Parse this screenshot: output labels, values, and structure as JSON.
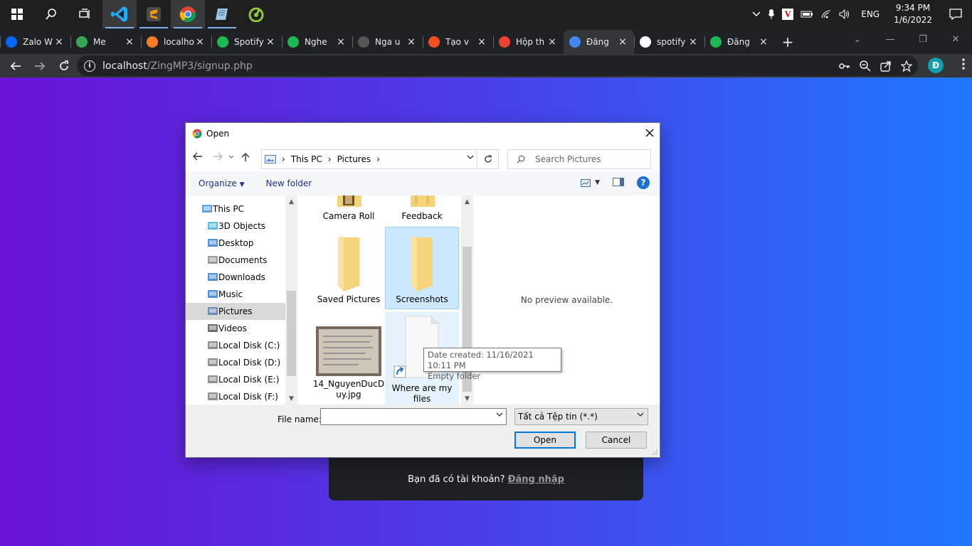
{
  "taskbar": {
    "apps": [
      "start-icon",
      "search-icon",
      "task-view-icon",
      "vscode-icon",
      "sublime-icon",
      "chrome-icon",
      "notes-icon",
      "coccoc-icon"
    ],
    "tray": {
      "lang": "ENG",
      "time": "9:34 PM",
      "date": "1/6/2022"
    }
  },
  "browser": {
    "tabs": [
      {
        "title": "Zalo W",
        "fav_color": "#0068ff"
      },
      {
        "title": "Me",
        "fav_color": "#34a853"
      },
      {
        "title": "localho",
        "fav_color": "#fb7a24"
      },
      {
        "title": "Spotify",
        "fav_color": "#1db954"
      },
      {
        "title": "Nghe",
        "fav_color": "#1db954"
      },
      {
        "title": "Nga u",
        "fav_color": "#555555"
      },
      {
        "title": "Tạo v",
        "fav_color": "#f25022"
      },
      {
        "title": "Hộp th",
        "fav_color": "#ea4335"
      },
      {
        "title": "Đăng",
        "fav_color": "#4285f4"
      },
      {
        "title": "spotify",
        "fav_color": "#ffffff"
      },
      {
        "title": "Đăng",
        "fav_color": "#1db954"
      }
    ],
    "active_tab_index": 8,
    "url_host": "localhost",
    "url_path": "/ZingMP3/signup.php",
    "profile_initial": "Đ"
  },
  "page": {
    "login_prompt": "Bạn đã có tài khoản?",
    "login_link": "Đăng nhập"
  },
  "dialog": {
    "title": "Open",
    "breadcrumb": [
      "This PC",
      "Pictures"
    ],
    "search_placeholder": "Search Pictures",
    "organize_label": "Organize",
    "new_folder_label": "New folder",
    "nav_items": [
      {
        "label": "This PC",
        "icon": "computer-icon"
      },
      {
        "label": "3D Objects",
        "icon": "cube-icon"
      },
      {
        "label": "Desktop",
        "icon": "desktop-icon"
      },
      {
        "label": "Documents",
        "icon": "document-icon"
      },
      {
        "label": "Downloads",
        "icon": "download-icon"
      },
      {
        "label": "Music",
        "icon": "music-icon"
      },
      {
        "label": "Pictures",
        "icon": "picture-icon"
      },
      {
        "label": "Videos",
        "icon": "video-icon"
      },
      {
        "label": "Local Disk (C:)",
        "icon": "drive-icon"
      },
      {
        "label": "Local Disk (D:)",
        "icon": "drive-icon"
      },
      {
        "label": "Local Disk (E:)",
        "icon": "drive-icon"
      },
      {
        "label": "Local Disk (F:)",
        "icon": "drive-icon"
      }
    ],
    "selected_nav": "Pictures",
    "files": [
      {
        "name": "Camera Roll",
        "kind": "folder"
      },
      {
        "name": "Feedback",
        "kind": "folder"
      },
      {
        "name": "Saved Pictures",
        "kind": "folder"
      },
      {
        "name": "Screenshots",
        "kind": "folder"
      },
      {
        "name": "14_NguyenDucDuy.jpg",
        "name_line1": "14_NguyenDucD",
        "name_line2": "uy.jpg",
        "kind": "image"
      },
      {
        "name": "Where are my files",
        "name_line1": "Where are my",
        "name_line2": "files",
        "kind": "shortcut"
      }
    ],
    "preview_text": "No preview available.",
    "tooltip": {
      "line1": "Date created: 11/16/2021 10:11 PM",
      "line2": "Empty folder"
    },
    "file_name_label": "File name:",
    "file_name_value": "",
    "filter_value": "Tất cả Tệp tin (*.*)",
    "open_label": "Open",
    "cancel_label": "Cancel"
  }
}
